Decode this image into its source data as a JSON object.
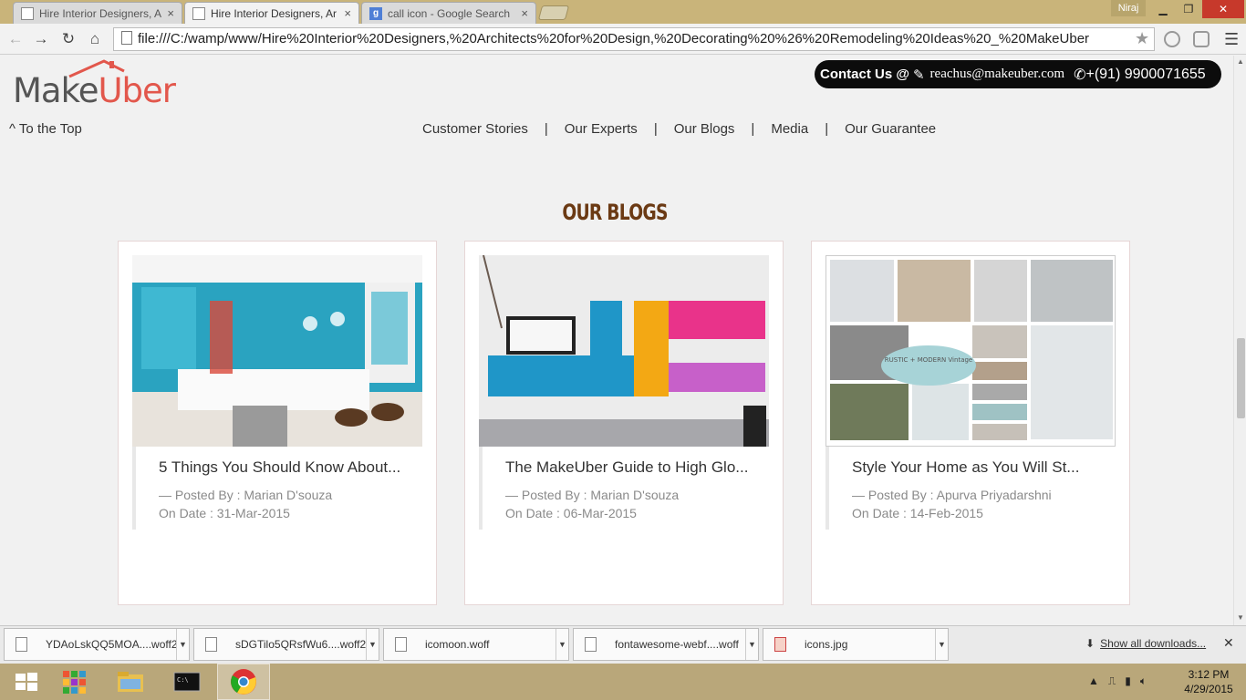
{
  "browser": {
    "tabs": [
      {
        "label": "Hire Interior Designers, Ar",
        "icon": "document-icon"
      },
      {
        "label": "Hire Interior Designers, Ar",
        "icon": "document-icon"
      },
      {
        "label": "call icon - Google Search",
        "icon": "google-icon"
      }
    ],
    "user": "Niraj",
    "address": "file:///C:/wamp/www/Hire%20Interior%20Designers,%20Architects%20for%20Design,%20Decorating%20%26%20Remodeling%20Ideas%20_%20MakeUber"
  },
  "site": {
    "logo_main": "Make",
    "logo_accent": "Uber",
    "brand_color": "#e2574c",
    "contact": {
      "label": "Contact Us @",
      "email": "reachus@makeuber.com",
      "phone": "+(91)  9900071655"
    },
    "to_top": "^ To the Top",
    "nav": [
      "Customer Stories",
      "Our Experts",
      "Our Blogs",
      "Media",
      "Our Guarantee"
    ],
    "nav_sep": "|",
    "section_title": "OUR BLOGS",
    "blogs": [
      {
        "title": "5 Things You Should Know About...",
        "posted_by": "— Posted By : Marian D'souza",
        "date": "On Date : 31-Mar-2015"
      },
      {
        "title": "The MakeUber Guide to High Glo...",
        "posted_by": "— Posted By : Marian D'souza",
        "date": "On Date : 06-Mar-2015"
      },
      {
        "title": "Style Your Home as You Will St...",
        "posted_by": "— Posted By : Apurva Priyadarshni",
        "date": "On Date : 14-Feb-2015"
      }
    ],
    "moodboard_text": "RUSTIC + MODERN Vintage"
  },
  "downloads": {
    "items": [
      "YDAoLskQQ5MOA....woff2",
      "sDGTilo5QRsfWu6....woff2",
      "icomoon.woff",
      "fontawesome-webf....woff",
      "icons.jpg"
    ],
    "show_all": "Show all downloads..."
  },
  "taskbar": {
    "time": "3:12 PM",
    "date": "4/29/2015"
  }
}
